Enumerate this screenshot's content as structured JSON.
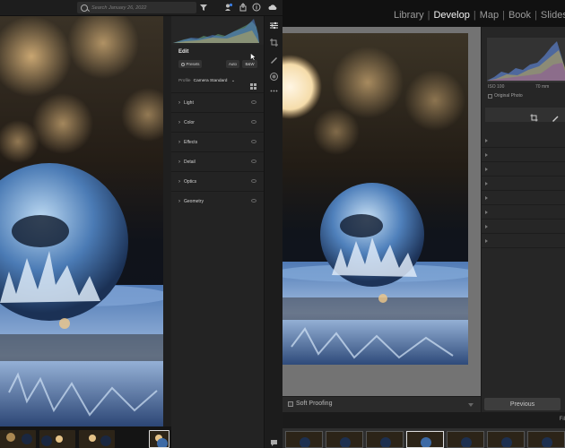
{
  "left_app": {
    "search": {
      "placeholder": "Search January 26, 2022"
    },
    "top_icons": [
      "filter-icon",
      "share-people-icon",
      "share-icon",
      "info-icon",
      "cloud-icon"
    ],
    "edit_panel": {
      "title": "Edit",
      "presets_label": "Presets",
      "auto_label": "Auto",
      "bw_label": "B&W",
      "profile_label": "Profile",
      "profile_value": "Camera Standard",
      "sections": [
        {
          "label": "Light"
        },
        {
          "label": "Color"
        },
        {
          "label": "Effects"
        },
        {
          "label": "Detail"
        },
        {
          "label": "Optics"
        },
        {
          "label": "Geometry"
        }
      ]
    },
    "tools": [
      "edit-sliders-icon",
      "crop-icon",
      "healing-brush-icon",
      "masking-icon",
      "more-icon"
    ],
    "filmstrip_count": 4
  },
  "right_app": {
    "modules": [
      "Library",
      "Develop",
      "Map",
      "Book",
      "Slideshow"
    ],
    "active_module": "Develop",
    "module_sep": "|",
    "histogram_info": {
      "iso": "ISO 100",
      "focal": "70 mm"
    },
    "original_photo_label": "Original Photo",
    "soft_proofing_label": "Soft Proofing",
    "previous_label": "Previous",
    "filmstrip_label": "Fil"
  },
  "colors": {
    "accent": "#4d8fd6",
    "panel_bg": "#232323",
    "classic_bg": "#2b2b2b"
  }
}
